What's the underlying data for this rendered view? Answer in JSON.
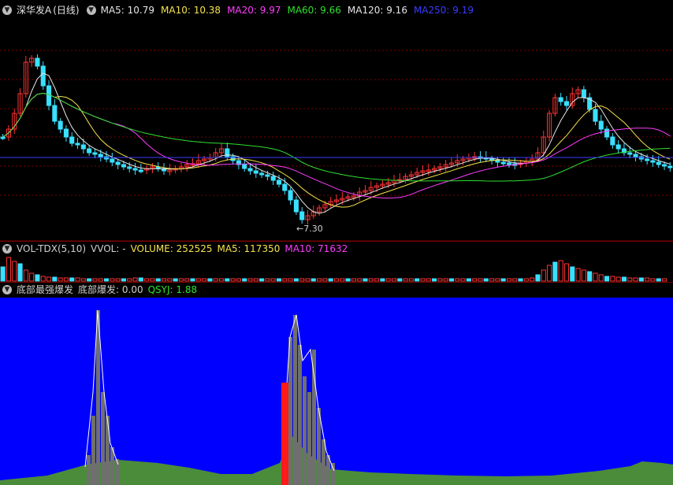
{
  "main_panel": {
    "stock_title": "深华发A",
    "period": "(日线)",
    "ma_items": [
      {
        "label": "MA5: 10.79",
        "color": "#e6e6e6"
      },
      {
        "label": "MA10: 10.38",
        "color": "#f5e34a"
      },
      {
        "label": "MA20: 9.97",
        "color": "#ff3cff"
      },
      {
        "label": "MA60: 9.66",
        "color": "#2fe02f"
      },
      {
        "label": "MA120: 9.16",
        "color": "#e6e6e6"
      },
      {
        "label": "MA250: 9.19",
        "color": "#3a3cff"
      }
    ],
    "low_annotation": "7.30"
  },
  "volume_panel": {
    "indicator": "VOL-TDX(5,10)",
    "vvol": "VVOL: -",
    "volume": "VOLUME: 252525",
    "ma5": "MA5: 117350",
    "ma10": "MA10: 71632"
  },
  "indicator_panel": {
    "name": "底部最强爆发",
    "value_label": "底部爆发: 0.00",
    "qsyj": "QSYJ: 1.88"
  },
  "colors": {
    "up": "#ff3333",
    "down": "#39e0ff",
    "panel_bg": "#0000ff",
    "area": "#4a8c3a"
  }
}
